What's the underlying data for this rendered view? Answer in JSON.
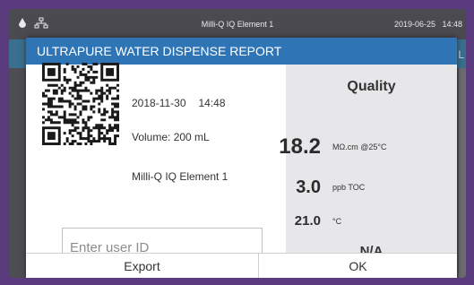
{
  "statusbar": {
    "device_name": "Milli-Q IQ Element 1",
    "date": "2019-06-25",
    "time": "14:48",
    "icons": [
      "water-drop-icon",
      "network-icon"
    ]
  },
  "background": {
    "edge_text": "L"
  },
  "dialog": {
    "title": "ULTRAPURE WATER DISPENSE REPORT",
    "date": "2018-11-30",
    "time": "14:48",
    "volume": "Volume: 200 mL",
    "device_name": "Milli-Q IQ Element 1",
    "user_input_placeholder": "Enter user ID",
    "quality": {
      "title": "Quality",
      "resistivity": "18.2",
      "resistivity_unit": "MΩ.cm @25°C",
      "toc": "3.0",
      "toc_unit": "ppb TOC",
      "temperature": "21.0",
      "temperature_unit": "°C",
      "status": "N/A"
    },
    "buttons": {
      "export": "Export",
      "ok": "OK"
    }
  },
  "colors": {
    "header": "#2f75b5",
    "frame": "#5a3b7e",
    "panel": "#e7e7ea"
  }
}
